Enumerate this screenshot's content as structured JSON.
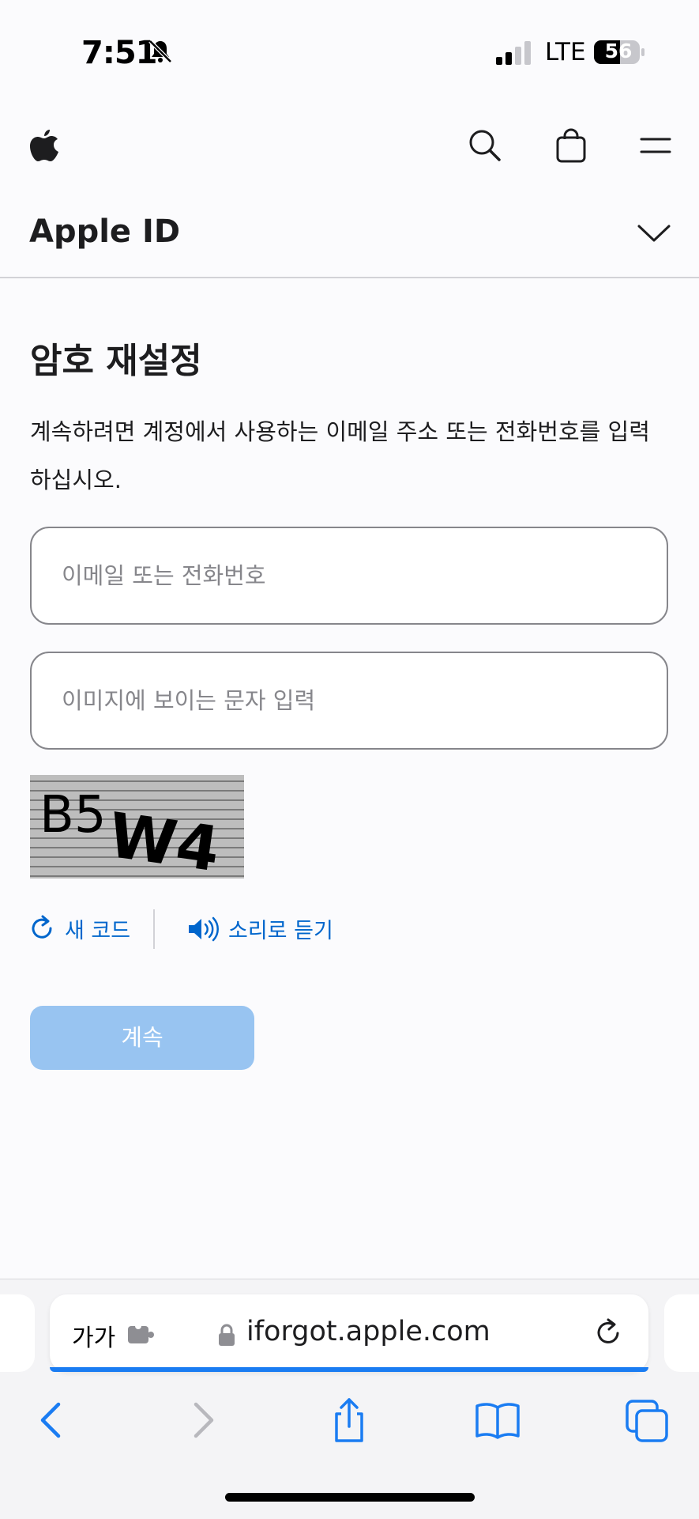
{
  "status_bar": {
    "time": "7:51",
    "network": "LTE",
    "battery": "56"
  },
  "nav": {
    "apple_logo": "apple-logo-icon",
    "search_icon": "search-icon",
    "bag_icon": "bag-icon",
    "menu_icon": "menu-icon"
  },
  "section": {
    "title": "Apple ID"
  },
  "form": {
    "heading": "암호 재설정",
    "description": "계속하려면 계정에서 사용하는 이메일 주소 또는 전화번호를 입력하십시오.",
    "email_placeholder": "이메일 또는 전화번호",
    "captcha_placeholder": "이미지에 보이는 문자 입력",
    "captcha_text": "B5W4",
    "new_code_label": "새 코드",
    "listen_label": "소리로 듣기",
    "continue_label": "계속"
  },
  "browser": {
    "text_size_label": "가가",
    "url": "iforgot.apple.com"
  },
  "colors": {
    "link": "#0066cc",
    "button_disabled": "#98c4f1",
    "progress": "#1a7cf2"
  }
}
